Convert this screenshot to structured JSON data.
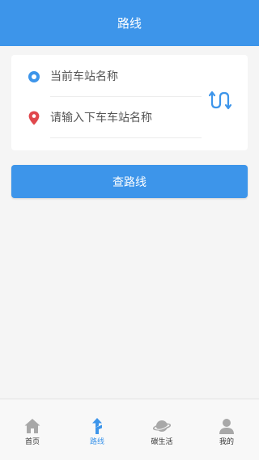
{
  "header": {
    "title": "路线"
  },
  "route_form": {
    "start": {
      "placeholder": "当前车站名称",
      "value": ""
    },
    "end": {
      "placeholder": "请输入下车车站名称",
      "value": ""
    },
    "swap_icon": "swap-route-icon"
  },
  "query_button": {
    "label": "查路线"
  },
  "tabbar": {
    "tabs": [
      {
        "label": "首页",
        "icon": "home-icon",
        "active": false
      },
      {
        "label": "路线",
        "icon": "route-icon",
        "active": true
      },
      {
        "label": "碳生活",
        "icon": "planet-icon",
        "active": false
      },
      {
        "label": "我的",
        "icon": "user-icon",
        "active": false
      }
    ]
  },
  "colors": {
    "primary": "#3d95ea",
    "end_marker": "#e0474c",
    "tab_inactive": "#a8a8a8",
    "background": "#f5f5f5"
  }
}
